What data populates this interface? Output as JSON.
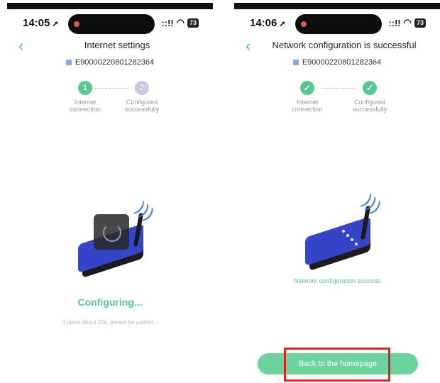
{
  "screens": [
    {
      "status": {
        "time": "14:05",
        "loc_icon": "➚",
        "signal": "::!!",
        "wifi": "wifi-icon",
        "battery": "73"
      },
      "title": "Internet settings",
      "device_id": "E90000220801282364",
      "steps": [
        {
          "number": "1",
          "label": "Internet connection",
          "state": "active"
        },
        {
          "number": "2",
          "label": "Configured successfully",
          "state": "pending"
        }
      ],
      "progress_text": "Configuring...",
      "hint": "It takes about 30s, please be patient..."
    },
    {
      "status": {
        "time": "14:06",
        "loc_icon": "➚",
        "signal": "::!!",
        "wifi": "wifi-icon",
        "battery": "73"
      },
      "title": "Network configuration is successful",
      "device_id": "E90000220801282364",
      "steps": [
        {
          "number": "✓",
          "label": "Internet connection",
          "state": "done"
        },
        {
          "number": "✓",
          "label": "Configured successfully",
          "state": "done"
        }
      ],
      "success_text": "Network configuration success",
      "button_label": "Back to the homepage"
    }
  ],
  "colors": {
    "accent": "#56c98c",
    "button": "#6cd39c",
    "router": "#3644c8",
    "highlight": "#e02020"
  }
}
